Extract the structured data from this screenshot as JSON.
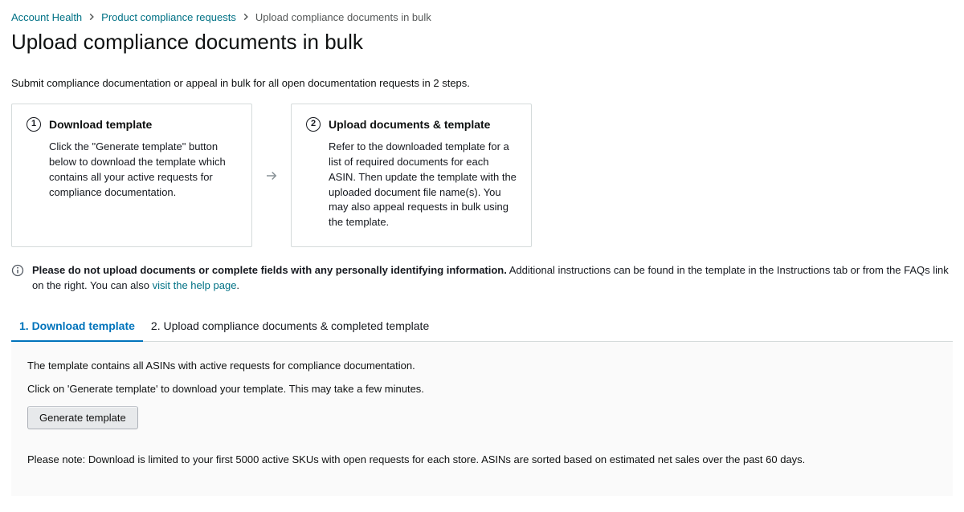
{
  "breadcrumb": {
    "items": [
      {
        "label": "Account Health",
        "link": true
      },
      {
        "label": "Product compliance requests",
        "link": true
      },
      {
        "label": "Upload compliance documents in bulk",
        "link": false
      }
    ]
  },
  "page_title": "Upload compliance documents in bulk",
  "subtitle": "Submit compliance documentation or appeal in bulk for all open documentation requests in 2 steps.",
  "steps": [
    {
      "num": "1",
      "title": "Download template",
      "body": "Click the \"Generate template\" button below to download the template which contains all your active requests for compliance documentation."
    },
    {
      "num": "2",
      "title": "Upload documents & template",
      "body": "Refer to the downloaded template for a list of required documents for each ASIN. Then update the template with the uploaded document file name(s). You may also appeal requests in bulk using the template."
    }
  ],
  "notice": {
    "bold": "Please do not upload documents or complete fields with any personally identifying information.",
    "rest_before_link": " Additional instructions can be found in the template in the Instructions tab or from the FAQs link on the right. You can also ",
    "link_text": "visit the help page",
    "rest_after_link": "."
  },
  "tabs": [
    {
      "label": "1. Download template",
      "active": true
    },
    {
      "label": "2. Upload compliance documents & completed template",
      "active": false
    }
  ],
  "panel": {
    "line1": "The template contains all ASINs with active requests for compliance documentation.",
    "line2": "Click on 'Generate template' to download your template. This may take a few minutes.",
    "button": "Generate template",
    "note": "Please note: Download is limited to your first 5000 active SKUs with open requests for each store. ASINs are sorted based on estimated net sales over the past 60 days."
  }
}
